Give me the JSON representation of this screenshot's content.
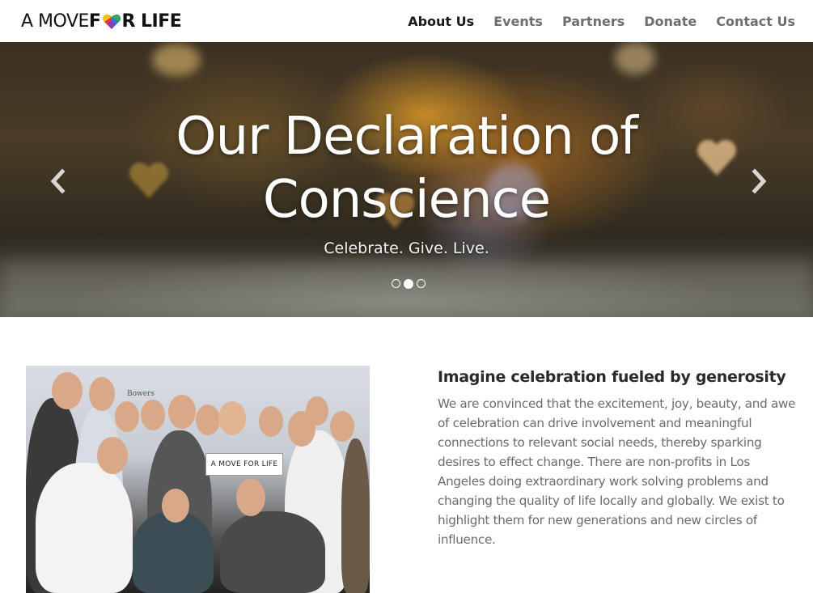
{
  "header": {
    "logo": {
      "part1": "A MOVE ",
      "part2": "F",
      "part3": "R LIFE"
    },
    "nav": [
      {
        "label": "About Us",
        "active": true
      },
      {
        "label": "Events",
        "active": false
      },
      {
        "label": "Partners",
        "active": false
      },
      {
        "label": "Donate",
        "active": false
      },
      {
        "label": "Contact Us",
        "active": false
      }
    ]
  },
  "hero": {
    "title_line1": "Our Declaration of",
    "title_line2": "Conscience",
    "subtitle": "Celebrate. Give. Live.",
    "slide_count": 3,
    "active_slide": 2,
    "prev_icon": "chevron-left-icon",
    "next_icon": "chevron-right-icon"
  },
  "content": {
    "photo": {
      "sign_text": "A MOVE FOR LIFE",
      "sponsor_text": "Bowers"
    },
    "heading": "Imagine celebration fueled by generosity",
    "body": "We are convinced that the excitement, joy, beauty, and awe of celebration can drive involvement and meaningful connections to relevant social needs, thereby sparking desires to effect change. There are non-profits in Los Angeles doing extraordinary work solving problems and changing the quality of life locally and globally. We exist to highlight them for new generations and new circles of influence."
  },
  "colors": {
    "nav_active": "#1a1a1a",
    "nav_inactive": "#6e6e6e",
    "heading": "#2a2a2a",
    "body": "#6b6b6b",
    "heart_red": "#d93a3a",
    "heart_yellow": "#f2c21a",
    "heart_green": "#3aa35a",
    "heart_blue": "#2f7ad6"
  }
}
